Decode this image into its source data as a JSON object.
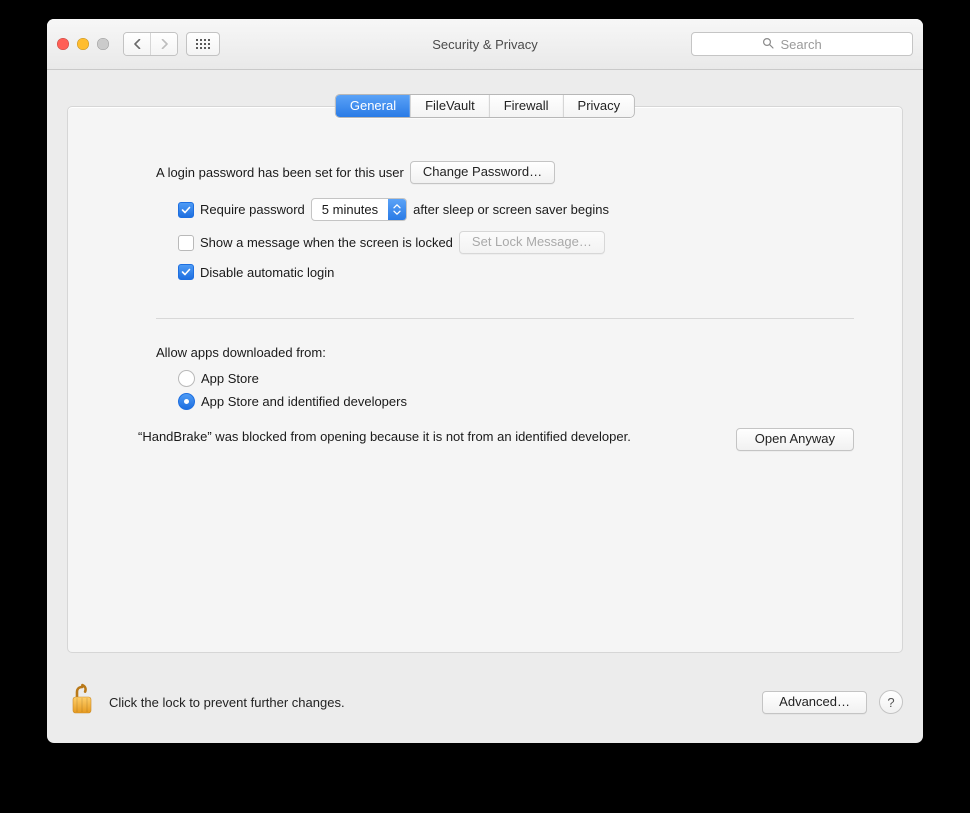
{
  "window": {
    "title": "Security & Privacy"
  },
  "toolbar": {
    "search_placeholder": "Search"
  },
  "tabs": [
    "General",
    "FileVault",
    "Firewall",
    "Privacy"
  ],
  "active_tab": 0,
  "login_section": {
    "intro": "A login password has been set for this user",
    "change_password_label": "Change Password…",
    "require_password_label": "Require password",
    "require_password_delay": "5 minutes",
    "require_password_suffix": "after sleep or screen saver begins",
    "require_password_checked": true,
    "show_message_label": "Show a message when the screen is locked",
    "show_message_checked": false,
    "set_lock_message_label": "Set Lock Message…",
    "disable_auto_login_label": "Disable automatic login",
    "disable_auto_login_checked": true
  },
  "allow_section": {
    "heading": "Allow apps downloaded from:",
    "options": [
      "App Store",
      "App Store and identified developers"
    ],
    "selected": 1,
    "blocked_message": "“HandBrake” was blocked from opening because it is not from an identified developer.",
    "open_anyway_label": "Open Anyway"
  },
  "footer": {
    "lock_label": "Click the lock to prevent further changes.",
    "advanced_label": "Advanced…",
    "help_label": "?"
  }
}
